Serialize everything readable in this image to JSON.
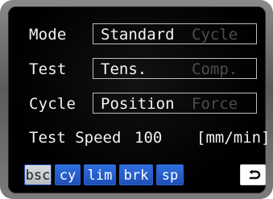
{
  "settings": [
    {
      "label": "Mode",
      "options": [
        "Standard",
        "Cycle"
      ],
      "selected_index": 0
    },
    {
      "label": "Test",
      "options": [
        "Tens.",
        "Comp."
      ],
      "selected_index": 0
    },
    {
      "label": "Cycle",
      "options": [
        "Position",
        "Force"
      ],
      "selected_index": 0
    }
  ],
  "speed": {
    "label": "Test Speed",
    "value": "100",
    "unit": "[mm/min]"
  },
  "tabs": [
    {
      "label": "bsc",
      "selected": true
    },
    {
      "label": "cy",
      "selected": false
    },
    {
      "label": "lim",
      "selected": false
    },
    {
      "label": "brk",
      "selected": false
    },
    {
      "label": "sp",
      "selected": false
    }
  ],
  "back_button": {
    "icon": "return-arrow-icon"
  },
  "colors": {
    "tab_blue": "#2f6fe0",
    "tab_selected": "#c9cdd2",
    "inactive_text": "#4d4d4d"
  }
}
